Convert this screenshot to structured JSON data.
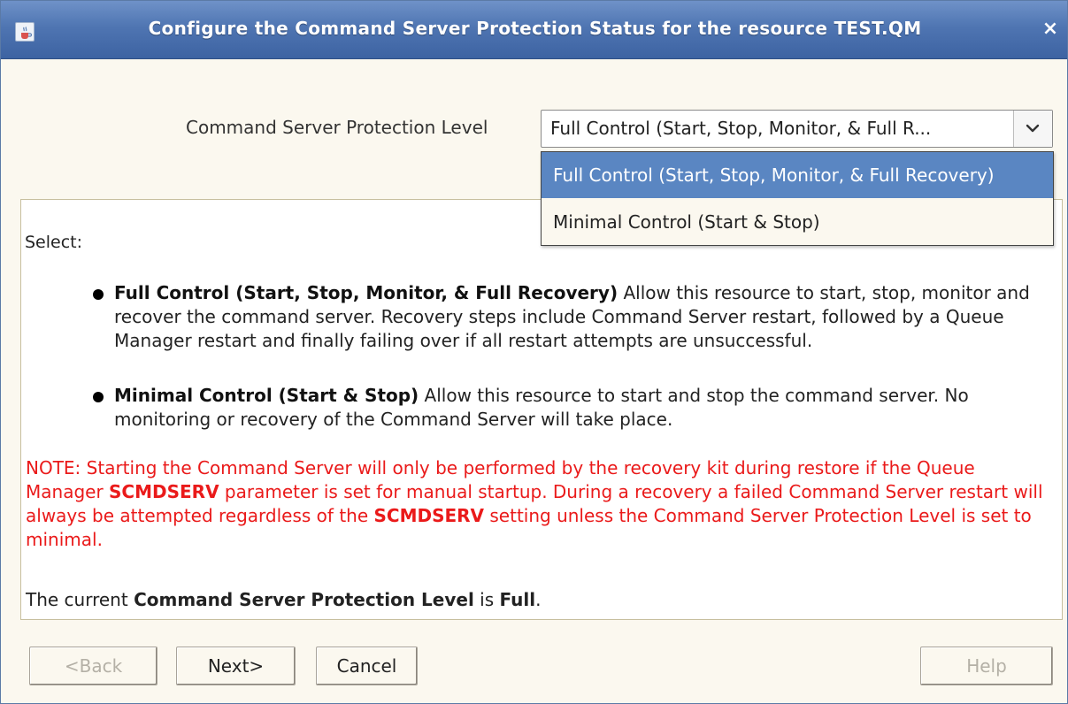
{
  "window": {
    "title": "Configure the Command Server Protection Status for the resource TEST.QM",
    "close_glyph": "×"
  },
  "protection": {
    "label": "Command Server Protection Level",
    "selected_value": "Full Control (Start, Stop, Monitor, & Full R...",
    "options": [
      "Full Control (Start, Stop, Monitor, & Full Recovery)",
      "Minimal Control (Start & Stop)"
    ]
  },
  "content": {
    "select_label": "Select:",
    "bullets": [
      {
        "title": "Full Control (Start, Stop, Monitor, & Full Recovery)",
        "text": " Allow this resource to start, stop, monitor and recover the command server. Recovery steps include Command Server restart, followed by a Queue Manager restart and finally failing over if all restart attempts are unsuccessful."
      },
      {
        "title": "Minimal Control (Start & Stop)",
        "text": " Allow this resource to start and stop the command server. No monitoring or recovery of the Command Server will take place."
      }
    ],
    "note": {
      "part1": "NOTE: Starting the Command Server will only be performed by the recovery kit during restore if the Queue Manager ",
      "keyword1": "SCMDSERV",
      "part2": " parameter is set for manual startup. During a recovery a failed Command Server restart will always be attempted regardless of the ",
      "keyword2": "SCMDSERV",
      "part3": " setting unless the Command Server Protection Level is set to minimal."
    },
    "current": {
      "prefix": "The current ",
      "bold_label": "Command Server Protection Level",
      "middle": " is ",
      "value": "Full",
      "suffix": "."
    }
  },
  "buttons": {
    "back": "<Back",
    "next": "Next>",
    "cancel": "Cancel",
    "help": "Help"
  },
  "colors": {
    "title_bar": "#4f75b2",
    "selection": "#5a86c2",
    "note_text": "#ea1a1a",
    "window_bg": "#fbf8ef"
  },
  "icons": {
    "title": "java-cup-icon",
    "close": "close-icon",
    "dropdown": "chevron-down-icon",
    "bullet": "bullet-dot-icon"
  }
}
